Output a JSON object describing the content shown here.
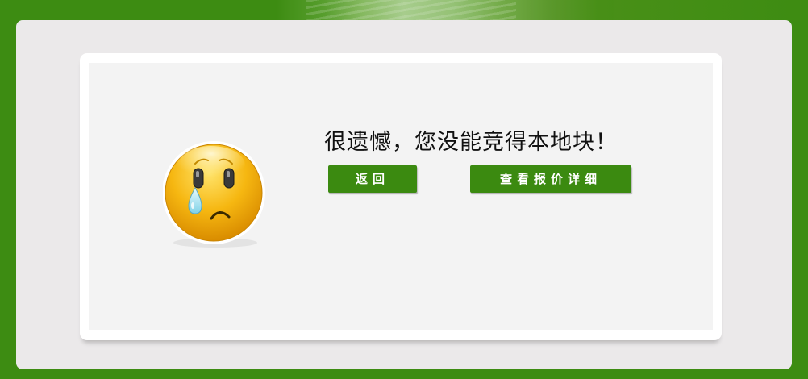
{
  "page": {
    "message": "很遗憾，您没能竞得本地块！"
  },
  "buttons": {
    "back_label": "返回",
    "detail_label": "查看报价详细"
  },
  "icons": {
    "face": "crying-face-icon"
  },
  "colors": {
    "frame_green": "#3d8c12",
    "button_green": "#3b8a10",
    "panel_gray": "#ebe9ea",
    "content_gray": "#f3f3f3"
  }
}
